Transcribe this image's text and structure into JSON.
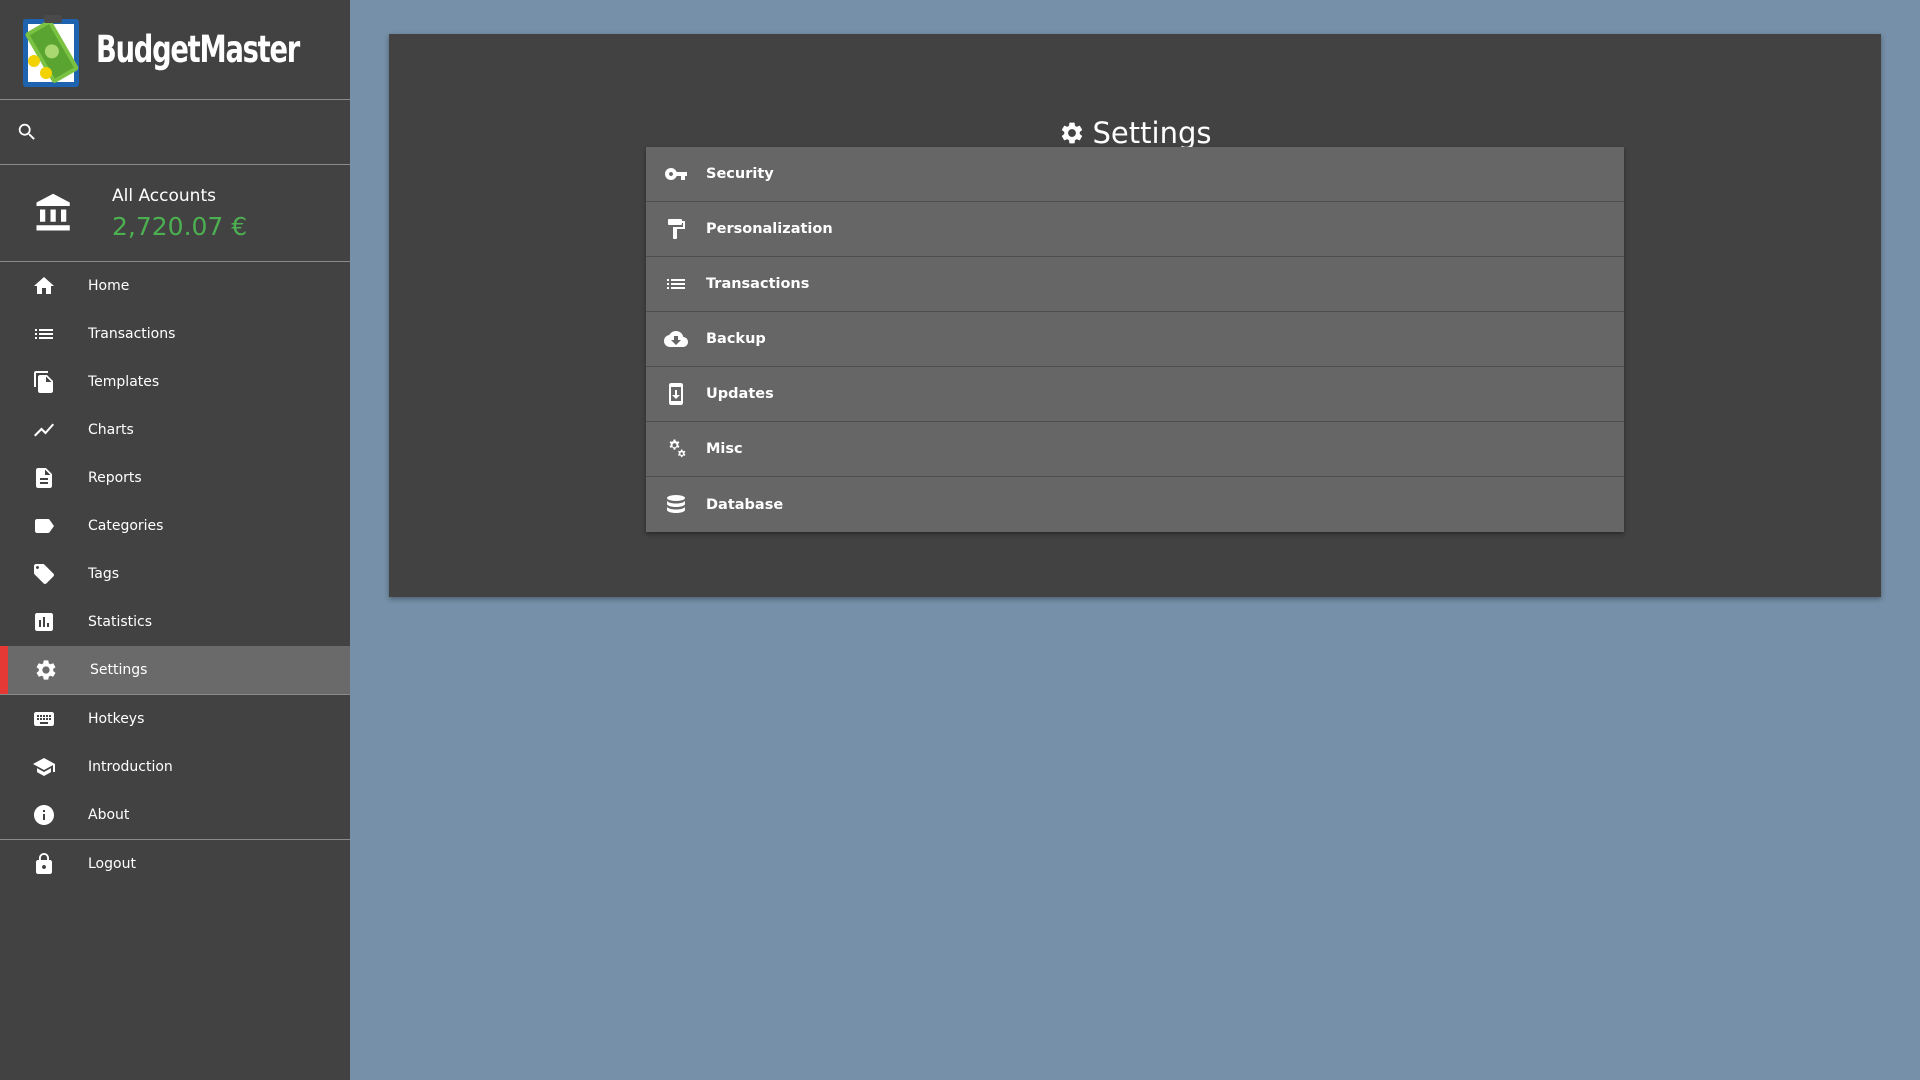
{
  "app": {
    "name": "BudgetMaster",
    "accent_color": "#e53935",
    "balance_color": "#4caf50"
  },
  "search": {
    "value": "",
    "icon": "search-icon"
  },
  "account": {
    "name": "All Accounts",
    "balance": "2,720.07 €",
    "icon": "bank-icon"
  },
  "nav": {
    "items": [
      {
        "label": "Home",
        "icon": "home-icon"
      },
      {
        "label": "Transactions",
        "icon": "list-icon"
      },
      {
        "label": "Templates",
        "icon": "file-copy-icon"
      },
      {
        "label": "Charts",
        "icon": "line-chart-icon"
      },
      {
        "label": "Reports",
        "icon": "document-icon"
      },
      {
        "label": "Categories",
        "icon": "label-icon"
      },
      {
        "label": "Tags",
        "icon": "tag-icon"
      },
      {
        "label": "Statistics",
        "icon": "bar-chart-icon"
      },
      {
        "label": "Settings",
        "icon": "gear-icon",
        "active": true
      },
      {
        "label": "Hotkeys",
        "icon": "keyboard-icon"
      },
      {
        "label": "Introduction",
        "icon": "school-icon"
      },
      {
        "label": "About",
        "icon": "info-icon"
      },
      {
        "label": "Logout",
        "icon": "lock-icon"
      }
    ]
  },
  "main": {
    "title": "Settings",
    "title_icon": "gear-icon",
    "sections": [
      {
        "label": "Security",
        "icon": "key-icon"
      },
      {
        "label": "Personalization",
        "icon": "paint-roller-icon"
      },
      {
        "label": "Transactions",
        "icon": "list-icon"
      },
      {
        "label": "Backup",
        "icon": "cloud-download-icon"
      },
      {
        "label": "Updates",
        "icon": "system-update-icon"
      },
      {
        "label": "Misc",
        "icon": "gears-icon"
      },
      {
        "label": "Database",
        "icon": "database-icon"
      }
    ]
  }
}
